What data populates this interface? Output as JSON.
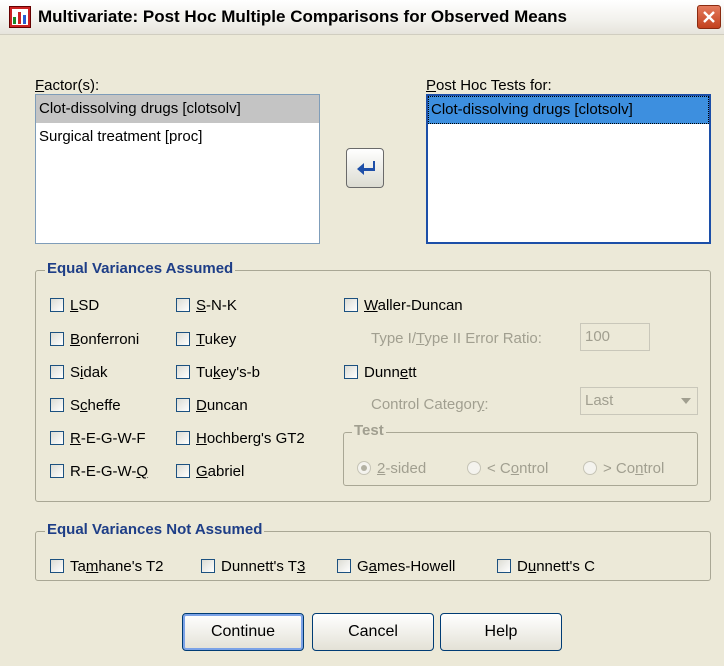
{
  "window": {
    "title": "Multivariate: Post Hoc Multiple Comparisons for Observed Means"
  },
  "factors": {
    "label": "Factor(s):",
    "items": [
      "Clot-dissolving drugs [clotsolv]",
      "Surgical treatment [proc]"
    ]
  },
  "posthoc": {
    "label": "Post Hoc Tests for:",
    "items": [
      "Clot-dissolving drugs [clotsolv]"
    ]
  },
  "equal_assumed": {
    "title": "Equal Variances Assumed",
    "col1": [
      "LSD",
      "Bonferroni",
      "Sidak",
      "Scheffe",
      "R-E-G-W-F",
      "R-E-G-W-Q"
    ],
    "col2": [
      "S-N-K",
      "Tukey",
      "Tukey's-b",
      "Duncan",
      "Hochberg's GT2",
      "Gabriel"
    ],
    "waller_duncan": "Waller-Duncan",
    "ratio_label": "Type I/Type II Error Ratio:",
    "ratio_value": "100",
    "dunnett": "Dunnett",
    "control_label": "Control Category:",
    "control_value": "Last",
    "test_title": "Test",
    "test_options": [
      "2-sided",
      "< Control",
      "> Control"
    ],
    "test_selected": "2-sided"
  },
  "equal_not_assumed": {
    "title": "Equal Variances Not Assumed",
    "items": [
      "Tamhane's T2",
      "Dunnett's T3",
      "Games-Howell",
      "Dunnett's C"
    ]
  },
  "buttons": {
    "continue": "Continue",
    "cancel": "Cancel",
    "help": "Help"
  }
}
